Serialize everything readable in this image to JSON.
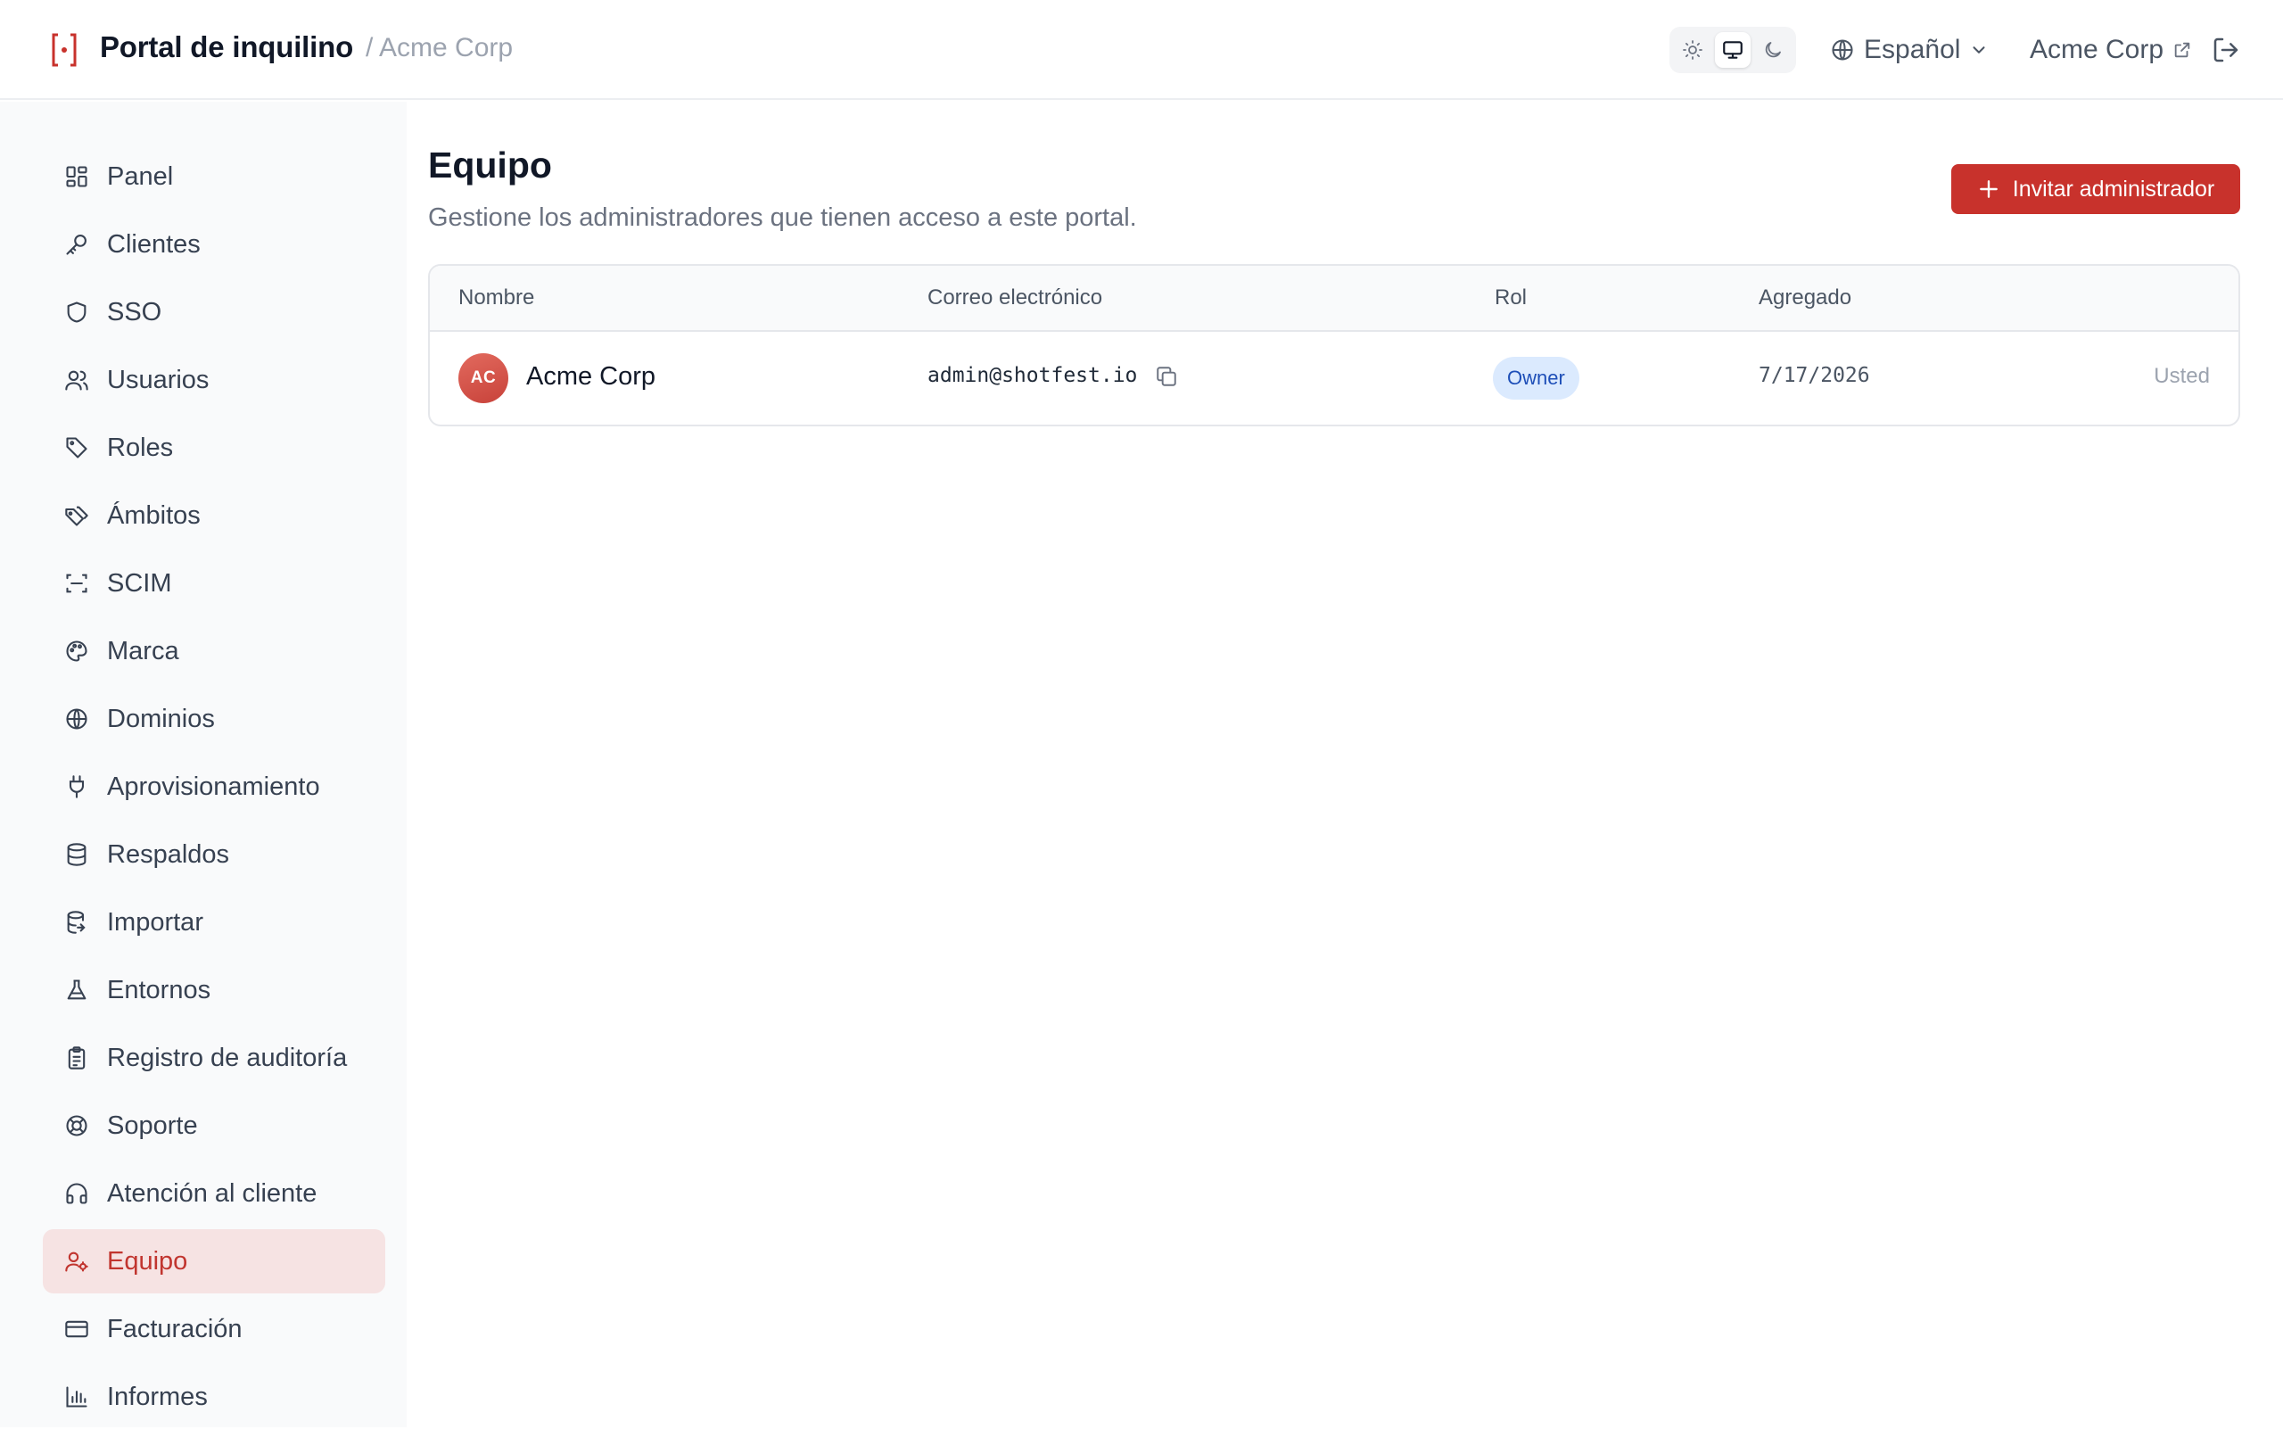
{
  "header": {
    "app_title": "Portal de inquilino",
    "breadcrumb": "/ Acme Corp",
    "theme_options": [
      {
        "name": "light",
        "icon": "sun-icon",
        "active": false
      },
      {
        "name": "system",
        "icon": "monitor-icon",
        "active": true
      },
      {
        "name": "dark",
        "icon": "moon-icon",
        "active": false
      }
    ],
    "language": "Español",
    "tenant_link": "Acme Corp"
  },
  "sidebar": {
    "items": [
      {
        "label": "Panel",
        "icon": "dashboard-icon",
        "active": false
      },
      {
        "label": "Clientes",
        "icon": "key-icon",
        "active": false
      },
      {
        "label": "SSO",
        "icon": "shield-icon",
        "active": false
      },
      {
        "label": "Usuarios",
        "icon": "users-icon",
        "active": false
      },
      {
        "label": "Roles",
        "icon": "tag-icon",
        "active": false
      },
      {
        "label": "Ámbitos",
        "icon": "tags-icon",
        "active": false
      },
      {
        "label": "SCIM",
        "icon": "scan-icon",
        "active": false
      },
      {
        "label": "Marca",
        "icon": "palette-icon",
        "active": false
      },
      {
        "label": "Dominios",
        "icon": "globe-icon",
        "active": false
      },
      {
        "label": "Aprovisionamiento",
        "icon": "plug-icon",
        "active": false
      },
      {
        "label": "Respaldos",
        "icon": "database-icon",
        "active": false
      },
      {
        "label": "Importar",
        "icon": "database-import-icon",
        "active": false
      },
      {
        "label": "Entornos",
        "icon": "flask-icon",
        "active": false
      },
      {
        "label": "Registro de auditoría",
        "icon": "clipboard-icon",
        "active": false
      },
      {
        "label": "Soporte",
        "icon": "lifebuoy-icon",
        "active": false
      },
      {
        "label": "Atención al cliente",
        "icon": "headphones-icon",
        "active": false
      },
      {
        "label": "Equipo",
        "icon": "user-cog-icon",
        "active": true
      },
      {
        "label": "Facturación",
        "icon": "credit-card-icon",
        "active": false
      },
      {
        "label": "Informes",
        "icon": "bar-chart-icon",
        "active": false
      }
    ]
  },
  "main": {
    "title": "Equipo",
    "subtitle": "Gestione los administradores que tienen acceso a este portal.",
    "invite_button": "Invitar administrador",
    "table": {
      "columns": [
        "Nombre",
        "Correo electrónico",
        "Rol",
        "Agregado"
      ],
      "rows": [
        {
          "initials": "AC",
          "name": "Acme Corp",
          "email": "admin@shotfest.io",
          "role": "Owner",
          "added": "7/17/2026",
          "note": "Usted"
        }
      ]
    }
  },
  "colors": {
    "accent": "#c8322c",
    "active_nav_bg": "#f6e3e3",
    "badge_bg": "#dbeafe",
    "badge_text": "#1e4fb8"
  }
}
